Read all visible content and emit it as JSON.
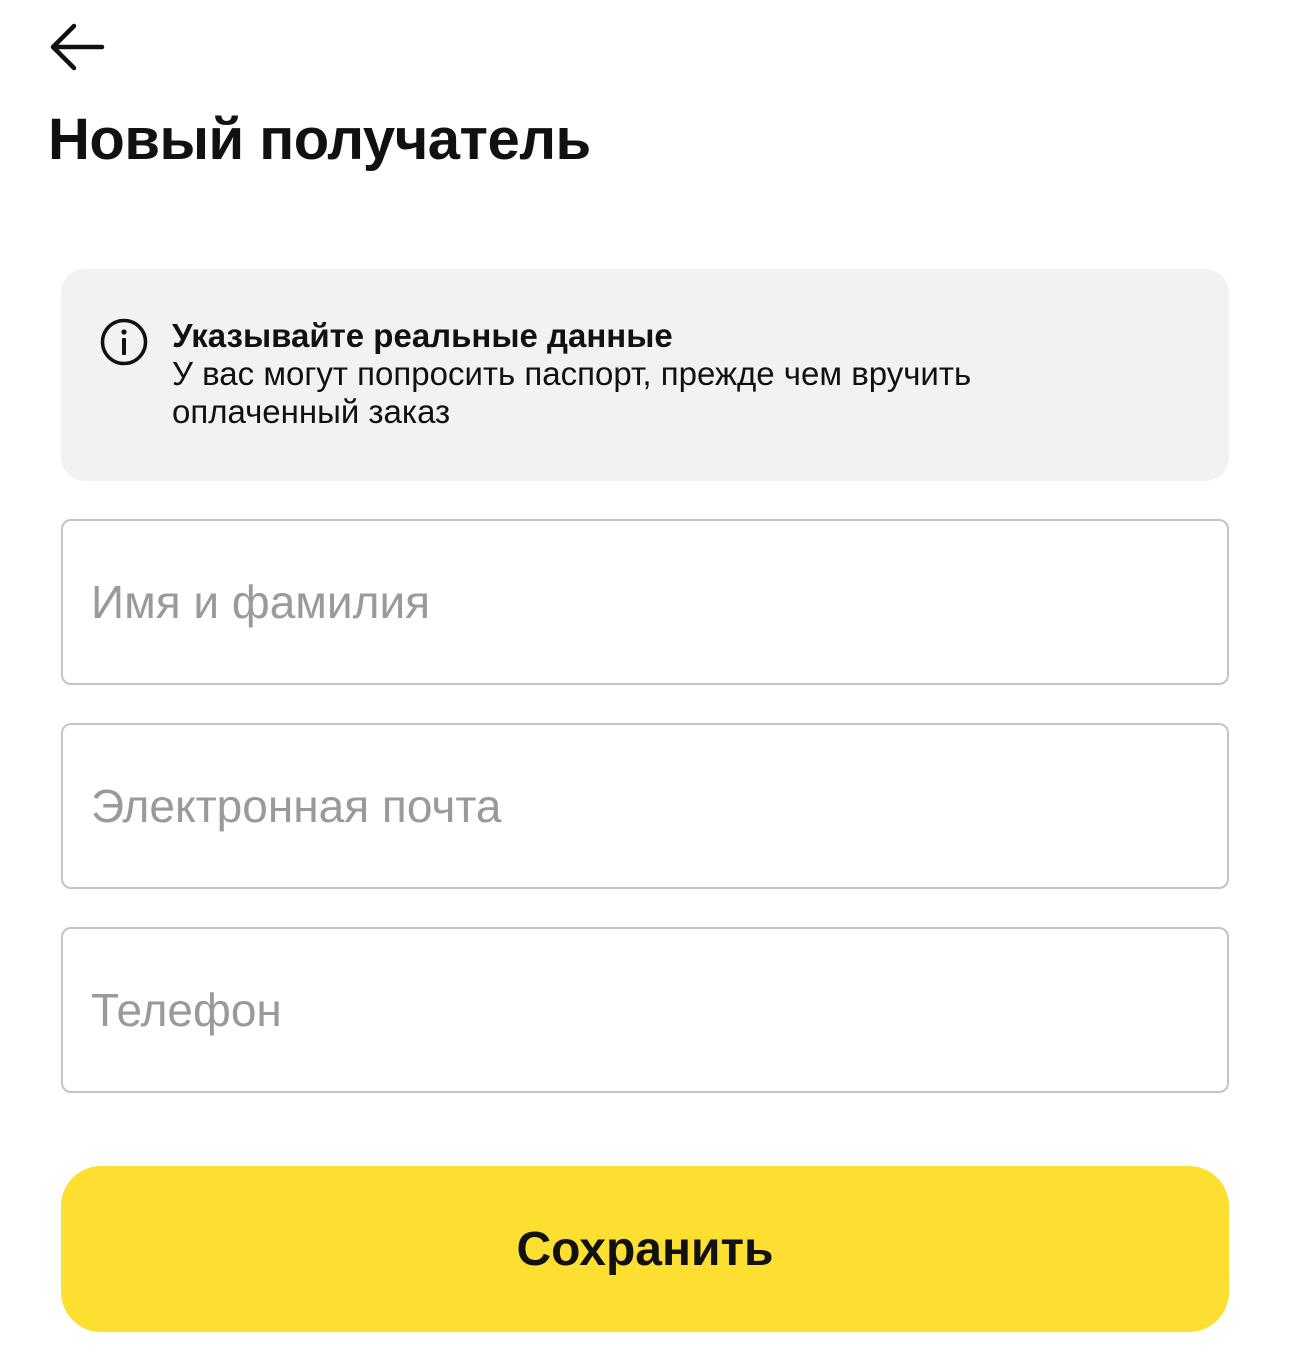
{
  "header": {
    "back_icon": "arrow-left-icon",
    "title": "Новый получатель"
  },
  "info_card": {
    "icon": "info-circle-icon",
    "title": "Указывайте реальные данные",
    "body_line1": "У вас могут попросить паспорт, прежде чем вручить",
    "body_line2": "оплаченный заказ",
    "background_color": "#f3f2f0"
  },
  "form": {
    "name": {
      "placeholder": "Имя и фамилия",
      "value": ""
    },
    "email": {
      "placeholder": "Электронная почта",
      "value": ""
    },
    "phone": {
      "placeholder": "Телефон",
      "value": ""
    }
  },
  "actions": {
    "save_label": "Сохранить",
    "save_color": "#fcdf31"
  }
}
